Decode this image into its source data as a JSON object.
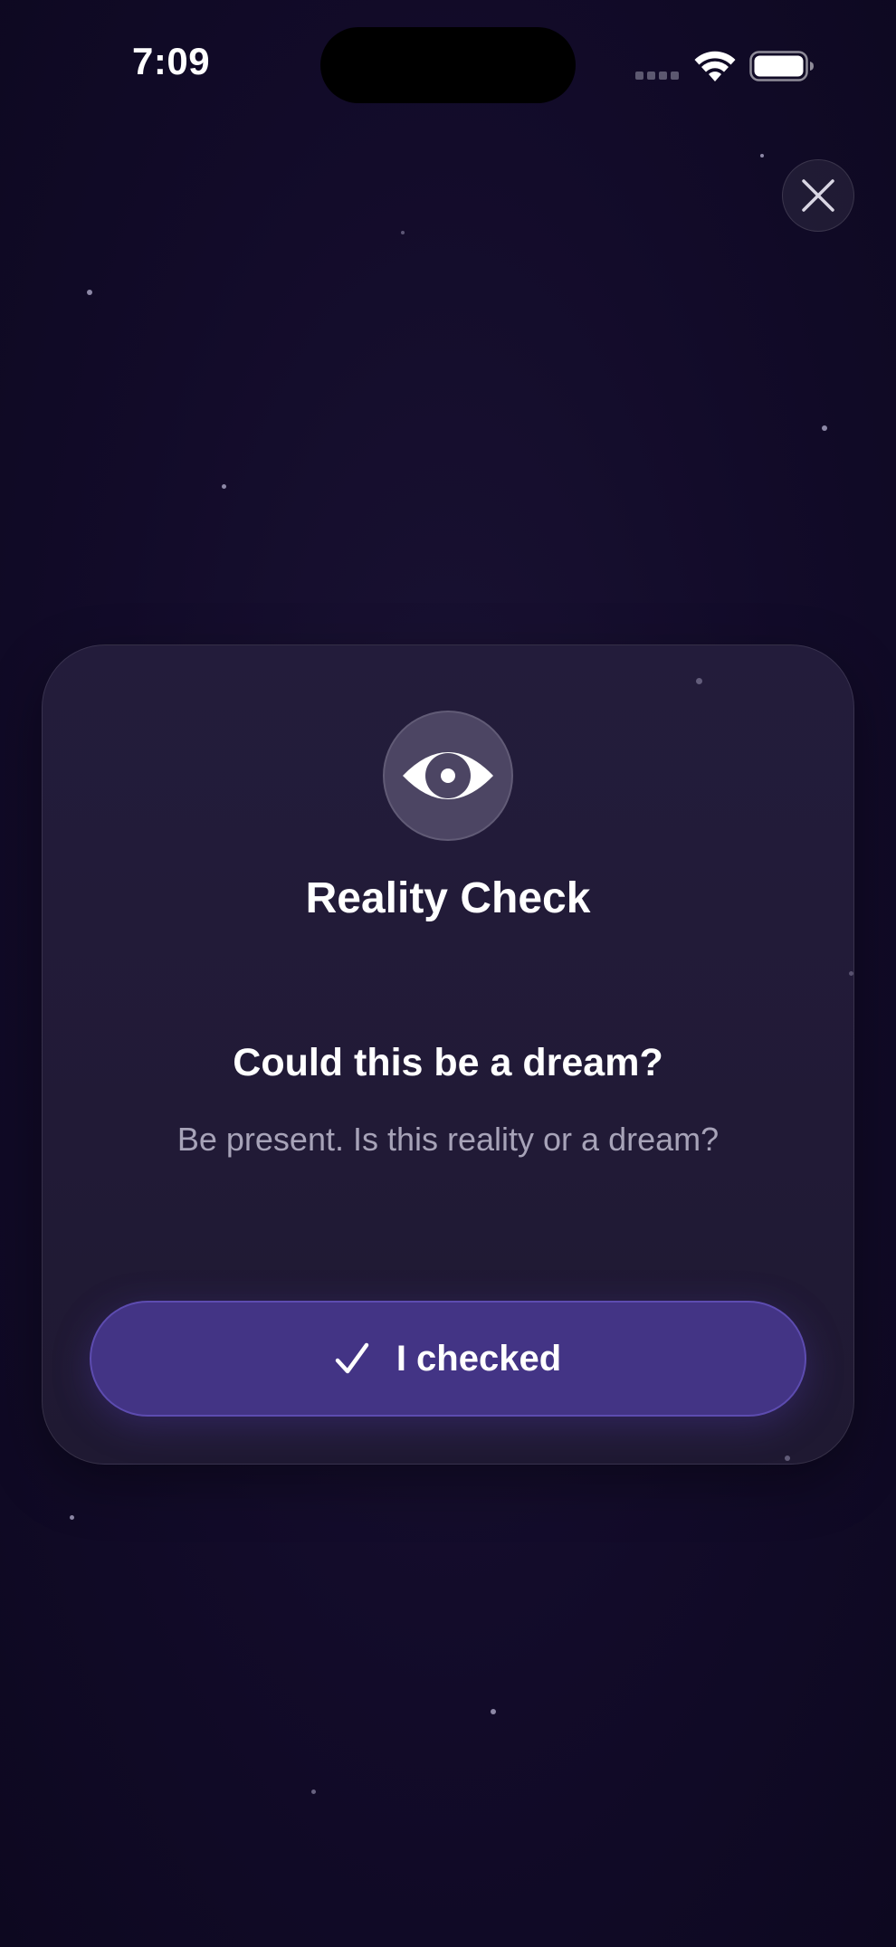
{
  "status_bar": {
    "time": "7:09"
  },
  "close_button": {
    "icon": "close-icon"
  },
  "card": {
    "icon": "eye-icon",
    "title": "Reality Check",
    "question": "Could this be a dream?",
    "subtitle": "Be present. Is this reality or a dream?",
    "button": {
      "icon": "checkmark-icon",
      "label": "I checked"
    }
  },
  "colors": {
    "background": "#100a24",
    "card": "#221b38",
    "button": "#433485",
    "button_border": "#5d4cb0",
    "subtitle_text": "#a7a3b8"
  }
}
